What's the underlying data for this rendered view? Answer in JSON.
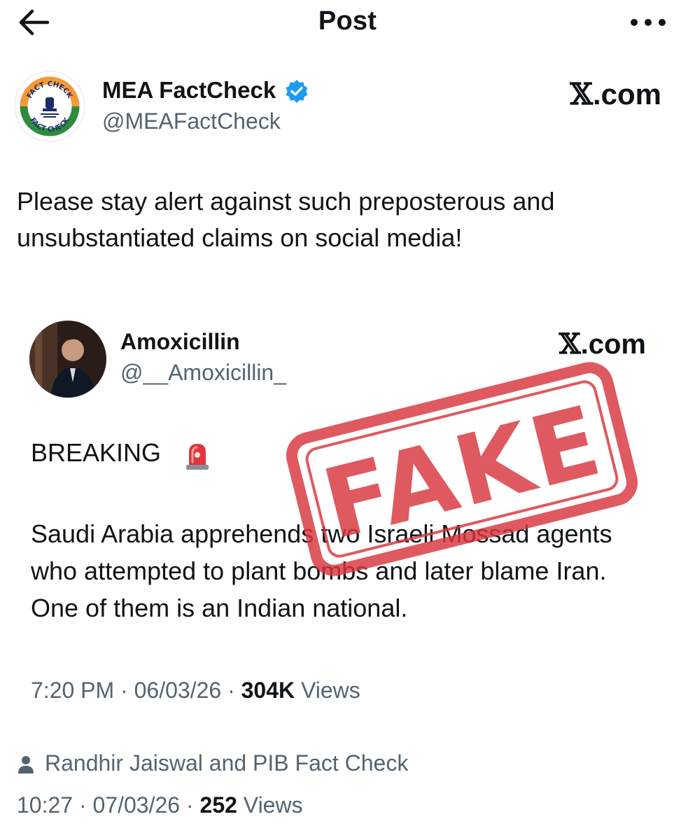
{
  "nav": {
    "title": "Post",
    "back_icon": "arrow-left-icon",
    "more_icon": "more-horizontal-icon"
  },
  "author": {
    "name": "MEA FactCheck",
    "handle": "@MEAFactCheck",
    "verified": true,
    "avatar_ring_text_top": "FACT CHECK",
    "avatar_ring_text_bottom": "FACT CHECK",
    "brand_mark": ".com",
    "brand_x": "𝕏"
  },
  "post": {
    "text": "Please stay alert against such preposterous and unsubstantiated claims on social media!"
  },
  "embedded": {
    "name": "Amoxicillin",
    "handle": "@__Amoxicillin_",
    "brand_mark": ".com",
    "brand_x": "𝕏",
    "breaking_label": "BREAKING",
    "body": "Saudi Arabia apprehends two Israeli Mossad agents who attempted to plant bombs and later blame Iran. One of them is an Indian national.",
    "stamp_text": "FAKE",
    "time": "7:20 PM",
    "date": "06/03/26",
    "views_count": "304K",
    "views_label": "Views"
  },
  "context": {
    "text": "Randhir Jaiswal and PIB Fact Check"
  },
  "meta": {
    "time": "10:27",
    "date": "07/03/26",
    "views_count": "252",
    "views_label": "Views"
  },
  "colors": {
    "text_primary": "#0f1419",
    "text_secondary": "#536471",
    "verified_blue": "#1d9bf0",
    "stamp_red": "#d9363e",
    "saffron": "#f29a3a",
    "green": "#2e8b3e",
    "navy": "#1b2b6b"
  }
}
